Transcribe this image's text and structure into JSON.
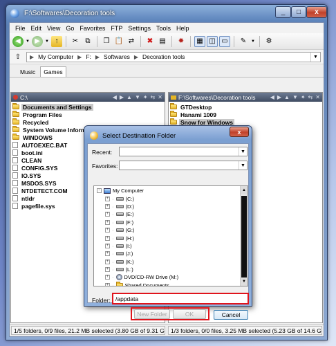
{
  "window": {
    "title": "F:\\Softwares\\Decoration tools",
    "close_label": "x",
    "min_label": "_",
    "max_label": "□"
  },
  "menu": [
    "File",
    "Edit",
    "View",
    "Go",
    "Favorites",
    "FTP",
    "Settings",
    "Tools",
    "Help"
  ],
  "address": {
    "segments": [
      "My Computer",
      "F:",
      "Softwares",
      "Decoration tools"
    ]
  },
  "tabs": [
    {
      "label": "Music",
      "active": false
    },
    {
      "label": "Games",
      "active": true
    }
  ],
  "left_pane": {
    "path": "C:\\",
    "items": [
      {
        "name": "Documents and Settings",
        "type": "folder",
        "selected": true
      },
      {
        "name": "Program Files",
        "type": "folder",
        "selected": false
      },
      {
        "name": "Recycled",
        "type": "folder",
        "selected": false
      },
      {
        "name": "System Volume Information",
        "type": "folder",
        "selected": false
      },
      {
        "name": "WINDOWS",
        "type": "folder",
        "selected": false
      },
      {
        "name": "AUTOEXEC.BAT",
        "type": "file",
        "selected": false
      },
      {
        "name": "boot.ini",
        "type": "file",
        "selected": false
      },
      {
        "name": "CLEAN",
        "type": "file",
        "selected": false
      },
      {
        "name": "CONFIG.SYS",
        "type": "file",
        "selected": false
      },
      {
        "name": "IO.SYS",
        "type": "file",
        "selected": false
      },
      {
        "name": "MSDOS.SYS",
        "type": "file",
        "selected": false
      },
      {
        "name": "NTDETECT.COM",
        "type": "file",
        "selected": false
      },
      {
        "name": "ntldr",
        "type": "file",
        "selected": false
      },
      {
        "name": "pagefile.sys",
        "type": "file",
        "selected": false
      }
    ]
  },
  "right_pane": {
    "path": "F:\\Softwares\\Decoration tools",
    "items": [
      {
        "name": "GTDesktop",
        "type": "folder",
        "selected": false
      },
      {
        "name": "Hanami 1009",
        "type": "folder",
        "selected": false
      },
      {
        "name": "Snow for Windows",
        "type": "folder",
        "selected": true
      }
    ]
  },
  "status": {
    "left": "1/5 folders, 0/9 files, 21.2 MB selected (3.80 GB of 9.31 GB",
    "right": "1/3 folders, 0/0 files, 3.25 MB selected (5.23 GB of 14.6 GB fre"
  },
  "dialog": {
    "title": "Select Destination Folder",
    "close_label": "x",
    "recent_label": "Recent:",
    "favorites_label": "Favorites:",
    "folder_label": "Folder:",
    "folder_value": "/appdata",
    "tree": [
      {
        "label": "My Computer",
        "icon": "computer",
        "level": 0,
        "expander": "-"
      },
      {
        "label": "(C:)",
        "icon": "drive",
        "level": 1,
        "expander": "+"
      },
      {
        "label": "(D:)",
        "icon": "drive",
        "level": 1,
        "expander": "+"
      },
      {
        "label": "(E:)",
        "icon": "drive",
        "level": 1,
        "expander": "+"
      },
      {
        "label": "(F:)",
        "icon": "drive",
        "level": 1,
        "expander": "+"
      },
      {
        "label": "(G:)",
        "icon": "drive",
        "level": 1,
        "expander": "+"
      },
      {
        "label": "(H:)",
        "icon": "drive",
        "level": 1,
        "expander": "+"
      },
      {
        "label": "(I:)",
        "icon": "drive",
        "level": 1,
        "expander": "+"
      },
      {
        "label": "(J:)",
        "icon": "drive",
        "level": 1,
        "expander": "+"
      },
      {
        "label": "(K:)",
        "icon": "drive",
        "level": 1,
        "expander": "+"
      },
      {
        "label": "(L:)",
        "icon": "drive",
        "level": 1,
        "expander": "+"
      },
      {
        "label": "DVD/CD-RW Drive (M:)",
        "icon": "cd",
        "level": 1,
        "expander": "+"
      },
      {
        "label": "Shared Documents",
        "icon": "folder",
        "level": 1,
        "expander": "+"
      }
    ],
    "buttons": {
      "new_folder": "New Folder",
      "ok": "OK",
      "cancel": "Cancel"
    }
  },
  "colors": {
    "highlight": "#e0141c",
    "selection": "#c8c8c8",
    "title_gradient": "#5f86bd"
  }
}
